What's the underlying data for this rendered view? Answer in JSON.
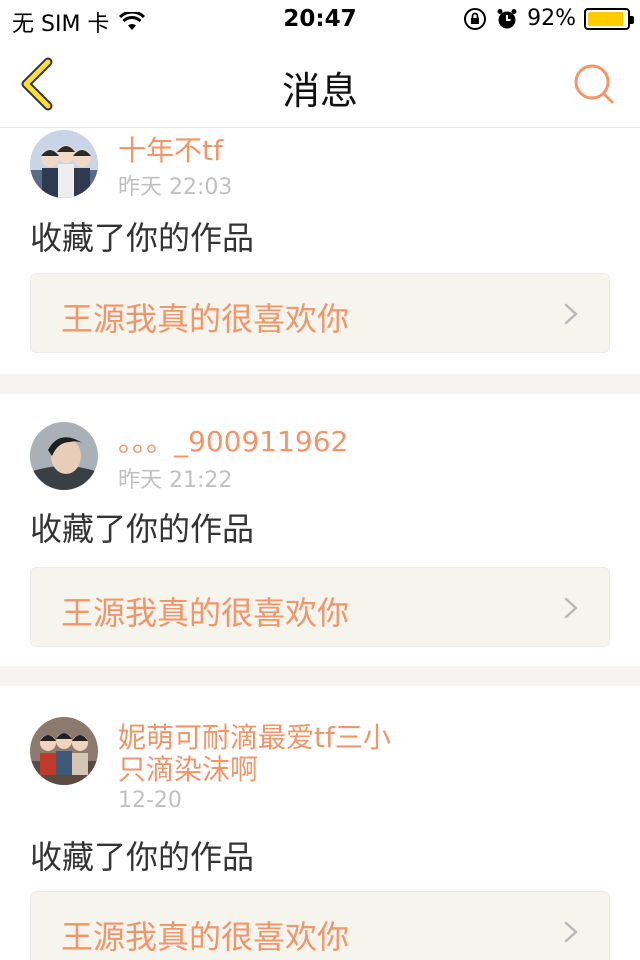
{
  "status_bar": {
    "carrier": "无 SIM 卡",
    "time": "20:47",
    "battery": "92%",
    "battery_level": 0.92,
    "battery_color": "#ffcc00"
  },
  "nav": {
    "title": "消息",
    "back_icon": "chevron-left-icon",
    "search_icon": "search-icon",
    "accent": "#f29569"
  },
  "messages": [
    {
      "user": "十年不tf",
      "time": "昨天 22:03",
      "action": "收藏了你的作品",
      "work": "王源我真的很喜欢你"
    },
    {
      "user": "。。。_900911962",
      "time": "昨天 21:22",
      "action": "收藏了你的作品",
      "work": "王源我真的很喜欢你"
    },
    {
      "user": "妮萌可耐滴最爱tf三小只滴染沫啊",
      "time": "12-20",
      "action": "收藏了你的作品",
      "work": "王源我真的很喜欢你"
    }
  ]
}
